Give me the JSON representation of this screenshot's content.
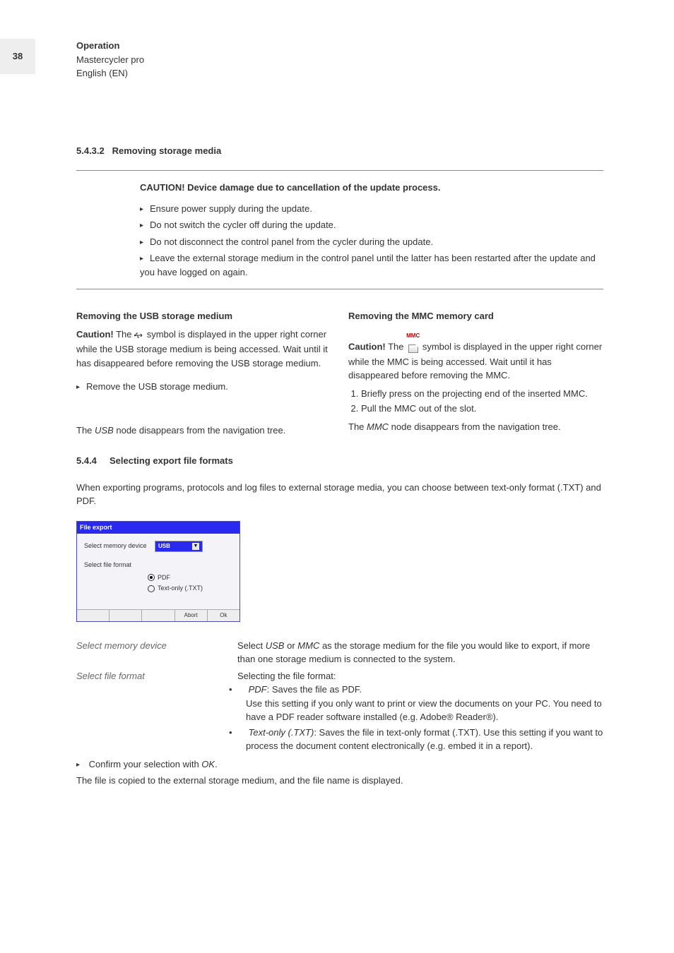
{
  "page_number": "38",
  "header": {
    "line1": "Operation",
    "line2": "Mastercycler pro",
    "line3": "English (EN)"
  },
  "sec5432": {
    "num": "5.4.3.2",
    "title": "Removing storage media",
    "caution_title": "CAUTION! Device damage due to cancellation of the update process.",
    "bullets": [
      "Ensure power supply during the update.",
      "Do not switch the cycler off during the update.",
      "Do not disconnect the control panel from the cycler during the update.",
      "Leave the external storage medium in the control panel until the latter has been restarted after the update and you have logged on again."
    ],
    "left": {
      "head": "Removing the USB storage medium",
      "caution_label": "Caution!",
      "caution_text_a": " The ",
      "caution_text_b": " symbol is displayed in the upper right corner while the USB storage medium is being accessed. Wait until it has disappeared before removing the USB storage medium.",
      "step1": "Remove the USB storage medium.",
      "note_a": "The ",
      "note_i": "USB",
      "note_b": " node disappears from the navigation tree."
    },
    "right": {
      "head": "Removing the MMC memory card",
      "caution_label": "Caution!",
      "caution_text_a": " The ",
      "caution_text_b": " symbol is displayed in the upper right corner while the MMC is being accessed. Wait until it has disappeared before removing the MMC.",
      "step1": "Briefly press on the projecting end of the inserted MMC.",
      "step2": "Pull the MMC out of the slot.",
      "note_a": "The ",
      "note_i": "MMC",
      "note_b": " node disappears from the navigation tree."
    }
  },
  "sec544": {
    "num": "5.4.4",
    "title": "Selecting export file formats",
    "intro": "When exporting programs, protocols and log files to external storage media, you can choose between text-only format (.TXT) and PDF.",
    "dialog": {
      "title": "File export",
      "label1": "Select memory device",
      "select_value": "USB",
      "label2": "Select file format",
      "opt1": "PDF",
      "opt2": "Text-only (.TXT)",
      "btn_abort": "Abort",
      "btn_ok": "Ok"
    },
    "defs": {
      "term1": "Select memory device",
      "body1_a": "Select ",
      "body1_i1": "USB",
      "body1_b": " or ",
      "body1_i2": "MMC",
      "body1_c": " as the storage medium for the file you would like to export, if more than one storage medium is connected to the system.",
      "term2": "Select file format",
      "body2_head": "Selecting the file format:",
      "body2_b1_i": "PDF",
      "body2_b1": ": Saves the file as PDF.",
      "body2_b1_cont": "Use this setting if you only want to print or view the documents on your PC. You need to have a PDF reader software installed (e.g. Adobe® Reader®).",
      "body2_b2_i": "Text-only (.TXT)",
      "body2_b2": ": Saves the file in text-only format (.TXT). Use this setting if you want to process the document content electronically (e.g. embed it in a report)."
    },
    "final_step_a": "Confirm your selection with ",
    "final_step_i": "OK",
    "final_step_b": ".",
    "final_note": "The file is copied to the external storage medium, and the file name is displayed."
  }
}
